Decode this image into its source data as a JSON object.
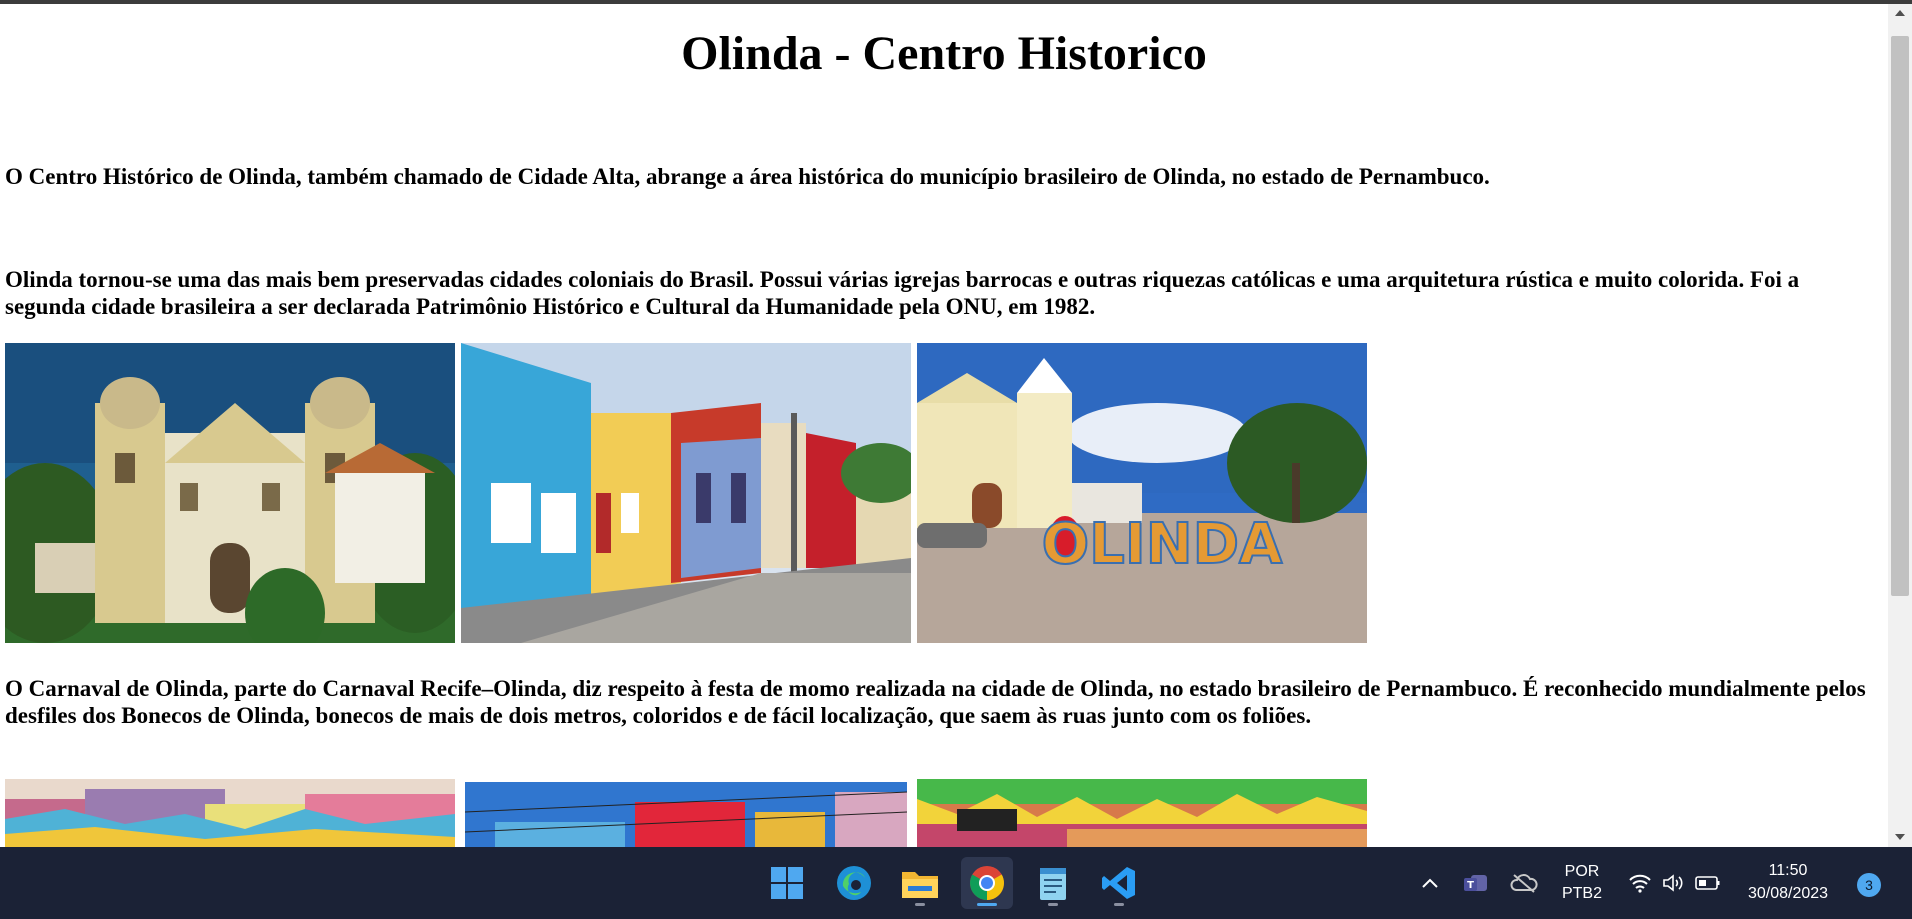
{
  "page": {
    "title": "Olinda - Centro Historico",
    "paragraph_1": "O Centro Histórico de Olinda, também chamado de Cidade Alta, abrange a área histórica do município brasileiro de Olinda, no estado de Pernambuco.",
    "paragraph_2": "Olinda tornou-se uma das mais bem preservadas cidades coloniais do Brasil. Possui várias igrejas barrocas e outras riquezas católicas e uma arquitetura rústica e muito colorida. Foi a segunda cidade brasileira a ser declarada Patrimônio Histórico e Cultural da Humanidade pela ONU, em 1982.",
    "paragraph_3": "O Carnaval de Olinda, parte do Carnaval Recife–Olinda, diz respeito à festa de momo realizada na cidade de Olinda, no estado brasileiro de Pernambuco. É reconhecido mundialmente pelos desfiles dos Bonecos de Olinda, bonecos de mais de dois metros, coloridos e de fácil localização, que saem às ruas junto com os foliões.",
    "sign_text": "OLINDA"
  },
  "taskbar": {
    "apps": [
      {
        "name": "windows-start",
        "icon": "windows-logo-icon",
        "active": false
      },
      {
        "name": "edge",
        "icon": "edge-icon",
        "active": false
      },
      {
        "name": "file-explorer",
        "icon": "folder-icon",
        "active": false
      },
      {
        "name": "chrome",
        "icon": "chrome-icon",
        "active": true
      },
      {
        "name": "notepad",
        "icon": "notepad-icon",
        "active": false
      },
      {
        "name": "vscode",
        "icon": "vscode-icon",
        "active": false
      }
    ],
    "language_1": "POR",
    "language_2": "PTB2",
    "time": "11:50",
    "date": "30/08/2023",
    "notifications": "3"
  },
  "colors": {
    "taskbar_bg": "#1b2236",
    "accent": "#4fa8f0",
    "scrollbar_thumb": "#c1c1c1"
  }
}
